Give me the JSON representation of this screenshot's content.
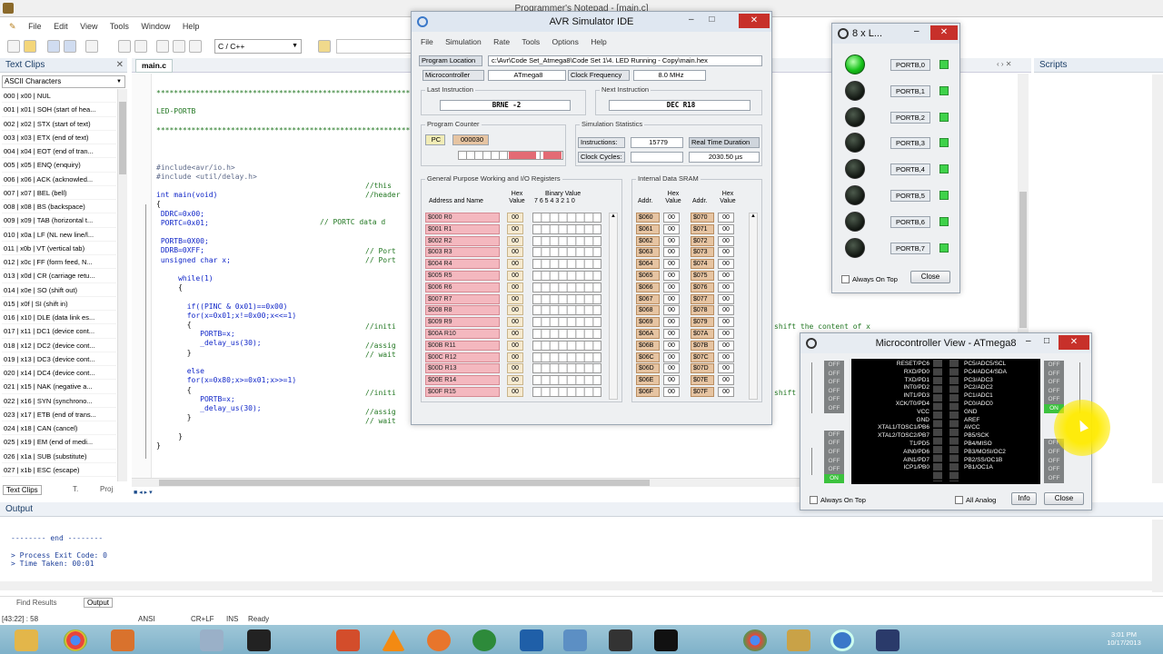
{
  "pn": {
    "title": "Programmer's Notepad - [main.c]",
    "menu": [
      "File",
      "Edit",
      "View",
      "Tools",
      "Window",
      "Help"
    ],
    "scheme": "C / C++",
    "textclips_title": "Text Clips",
    "ascii_label": "ASCII Characters",
    "clips": [
      "000 | x00 | NUL",
      "001 | x01 | SOH (start of hea...",
      "002 | x02 | STX (start of text)",
      "003 | x03 | ETX (end of text)",
      "004 | x04 | EOT (end of tran...",
      "005 | x05 | ENQ (enquiry)",
      "006 | x06 | ACK (acknowled...",
      "007 | x07 | BEL (bell)",
      "008 | x08 | BS (backspace)",
      "009 | x09 | TAB (horizontal t...",
      "010 | x0a | LF (NL new line/l...",
      "011 | x0b | VT (vertical tab)",
      "012 | x0c | FF (form feed, N...",
      "013 | x0d | CR (carriage retu...",
      "014 | x0e | SO (shift out)",
      "015 | x0f | SI (shift in)",
      "016 | x10 | DLE (data link es...",
      "017 | x11 | DC1 (device cont...",
      "018 | x12 | DC2 (device cont...",
      "019 | x13 | DC3 (device cont...",
      "020 | x14 | DC4 (device cont...",
      "021 | x15 | NAK (negative a...",
      "022 | x16 | SYN (synchrono...",
      "023 | x17 | ETB (end of trans...",
      "024 | x18 | CAN (cancel)",
      "025 | x19 | EM (end of medi...",
      "026 | x1a | SUB (substitute)",
      "027 | x1b | ESC (escape)"
    ],
    "tab_file": "main.c",
    "scripts_title": "Scripts",
    "bottom_tabs": [
      "Text Clips",
      "T.",
      "Proj"
    ],
    "code_right_1": "shift the content of x",
    "code_right_2": "shift",
    "output_title": "Output",
    "output_lines": [
      "-------- end --------",
      "",
      "> Process Exit Code: 0",
      "> Time Taken: 00:01"
    ],
    "out_tabs": [
      "Find Results",
      "Output"
    ],
    "status": [
      "[43:22] : 58",
      "ANSI",
      "CR+LF",
      "INS",
      "Ready"
    ],
    "clock_time": "3:01 PM",
    "clock_date": "10/17/2013"
  },
  "code": {
    "sep": "********************************************************************",
    "title": "LED-PORTB",
    "inc1": "#include<avr/io.h>",
    "inc2": "#include <util/delay.h>",
    "c_inc1": "//this",
    "c_inc2": "//header",
    "main": "int main(void)",
    "ob": "{",
    "ddrc": "DDRC=0x00;",
    "c_ddrc": "// PORTC data d",
    "portc": "PORTC=0x01;",
    "portb0": "PORTB=0X00;",
    "c_portb0": "// Port",
    "ddrb": "DDRB=0XFF;",
    "c_ddrb": "// Port",
    "uchar": "unsigned char x;",
    "while": "while(1)",
    "ob2": "{",
    "if": "if((PINC & 0x01)==0x00)",
    "for1": "for(x=0x01;x!=0x00;x<<=1)",
    "c_for1": "//initi",
    "ob3": "{",
    "portbx": "PORTB=x;",
    "c_assign": "//assig",
    "delay": "_delay_us(30);",
    "c_wait": "// wait",
    "cb3": "}",
    "else": "else",
    "for2": "for(x=0x80;x>=0x01;x>>=1)",
    "c_for2": "//initi",
    "ob4": "{",
    "portbx2": "PORTB=x;",
    "c_assign2": "//assig",
    "delay2": "_delay_us(30);",
    "c_wait2": "// wait",
    "cb4": "}",
    "cb2": "}",
    "cb1": "}"
  },
  "sim": {
    "title": "AVR Simulator IDE",
    "menu": [
      "File",
      "Simulation",
      "Rate",
      "Tools",
      "Options",
      "Help"
    ],
    "prog_loc_label": "Program Location",
    "prog_loc_value": "c:\\Avr\\Code Set_Atmega8\\Code Set 1\\4. LED Running - Copy\\main.hex",
    "mcu_label": "Microcontroller",
    "mcu_value": "ATmega8",
    "clk_label": "Clock Frequency",
    "clk_value": "8.0 MHz",
    "last_instr_label": "Last Instruction",
    "last_instr_value": "BRNE -2",
    "next_instr_label": "Next Instruction",
    "next_instr_value": "DEC R18",
    "pc_group": "Program Counter",
    "pc_label": "PC",
    "pc_value": "000030",
    "stats_group": "Simulation Statistics",
    "instr_label": "Instructions:",
    "instr_value": "15779",
    "rtd_label": "Real Time Duration",
    "clk_cycles_label": "Clock Cycles:",
    "duration_value": "2030.50 µs",
    "gpr_group": "General Purpose Working and I/O Registers",
    "gpr_col1": "Address and Name",
    "gpr_col2": "Hex Value",
    "gpr_col3": "Binary Value",
    "gpr_bits": "7 6 5 4 3 2 1 0",
    "sram_group": "Internal Data SRAM",
    "sram_addr": "Addr.",
    "sram_hex": "Hex Value",
    "regs": [
      "$000  R0",
      "$001  R1",
      "$002  R2",
      "$003  R3",
      "$004  R4",
      "$005  R5",
      "$006  R6",
      "$007  R7",
      "$008  R8",
      "$009  R9",
      "$00A  R10",
      "$00B  R11",
      "$00C  R12",
      "$00D  R13",
      "$00E  R14",
      "$00F  R15"
    ],
    "reg_val": "00",
    "sram_left": [
      "$060",
      "$061",
      "$062",
      "$063",
      "$064",
      "$065",
      "$066",
      "$067",
      "$068",
      "$069",
      "$06A",
      "$06B",
      "$06C",
      "$06D",
      "$06E",
      "$06F"
    ],
    "sram_right": [
      "$070",
      "$071",
      "$072",
      "$073",
      "$074",
      "$075",
      "$076",
      "$077",
      "$078",
      "$079",
      "$07A",
      "$07B",
      "$07C",
      "$07D",
      "$07E",
      "$07F"
    ]
  },
  "leds": {
    "title": "8 x L...",
    "labels": [
      "PORTB,0",
      "PORTB,1",
      "PORTB,2",
      "PORTB,3",
      "PORTB,4",
      "PORTB,5",
      "PORTB,6",
      "PORTB,7"
    ],
    "lit": [
      1,
      0,
      0,
      0,
      0,
      0,
      0,
      0
    ],
    "always_on_top": "Always On Top",
    "close": "Close"
  },
  "mcv": {
    "title": "Microcontroller View - ATmega8",
    "left_pins": "RESET/PC6\nRXD/PD0\nTXD/PD1\nINT0/PD2\nINT1/PD3\nXCK/T0/PD4\nVCC\nGND\nXTAL1/TOSC1/PB6\nXTAL2/TOSC2/PB7\nT1/PD5\nAIN0/PD6\nAIN1/PD7\nICP1/PB0",
    "right_pins": "PC5/ADC5/SCL\nPC4/ADC4/SDA\nPC3/ADC3\nPC2/ADC2\nPC1/ADC1\nPC0/ADC0\nGND\nAREF\nAVCC\nPB5/SCK\nPB4/MISO\nPB3/MOSI/OC2\nPB2/SS/OC1B\nPB1/OC1A",
    "off": "OFF",
    "on": "ON",
    "always_on_top": "Always On Top",
    "all_analog": "All Analog",
    "info": "Info",
    "close": "Close"
  }
}
